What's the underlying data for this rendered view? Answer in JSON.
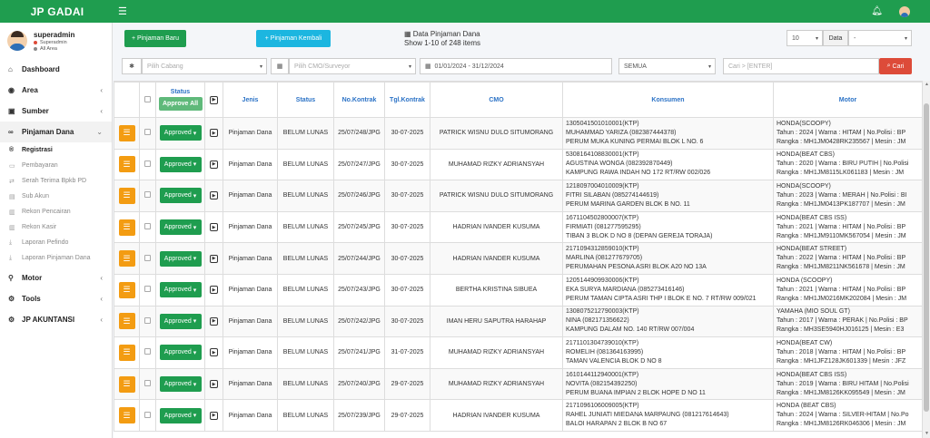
{
  "app": {
    "brand": "JP GADAI"
  },
  "icons": {
    "menu": "hamburger-icon",
    "bell": "bell-icon",
    "user": "user-avatar-icon"
  },
  "user": {
    "name": "superadmin",
    "role": "Superadmin",
    "area": "All Area"
  },
  "sidebar": {
    "items": [
      {
        "label": "Dashboard",
        "icon": "⌂",
        "has_children": false
      },
      {
        "label": "Area",
        "icon": "◉",
        "has_children": true
      },
      {
        "label": "Sumber",
        "icon": "▣",
        "has_children": true
      },
      {
        "label": "Pinjaman Dana",
        "icon": "∞",
        "has_children": true,
        "open": true
      }
    ],
    "submenu": [
      {
        "label": "Registrasi",
        "icon": "®",
        "active": true
      },
      {
        "label": "Pembayaran",
        "icon": "▭",
        "active": false
      },
      {
        "label": "Serah Terima Bpkb PD",
        "icon": "⇄",
        "active": false
      },
      {
        "label": "Sub Akun",
        "icon": "▤",
        "active": false
      },
      {
        "label": "Rekon Pencairan",
        "icon": "▥",
        "active": false
      },
      {
        "label": "Rekon Kasir",
        "icon": "▥",
        "active": false
      },
      {
        "label": "Laporan Pefindo",
        "icon": "⤓",
        "active": false
      },
      {
        "label": "Laporan Pinjaman Dana",
        "icon": "⤓",
        "active": false
      }
    ],
    "bottom_items": [
      {
        "label": "Motor",
        "icon": "⚲",
        "has_children": true
      },
      {
        "label": "Tools",
        "icon": "⚙",
        "has_children": true
      },
      {
        "label": "JP AKUNTANSI",
        "icon": "⚙",
        "has_children": true
      }
    ]
  },
  "toolbar": {
    "new_label": "+ Pinjaman Baru",
    "return_label": "+ Pinjaman Kembali",
    "info_title": "Data Pinjaman Dana",
    "info_count": "Show 1-10 of 248 items",
    "page_size": "10",
    "page_size_label": "Data",
    "extra_select": "-"
  },
  "filters": {
    "cabang_placeholder": "Pilih Cabang",
    "cmo_placeholder": "Pilih CMO/Surveyor",
    "date_range": "01/01/2024 - 31/12/2024",
    "status": "SEMUA",
    "search_placeholder": "Cari > [ENTER]",
    "search_button": "Cari"
  },
  "table": {
    "columns": {
      "status_header": "Status",
      "approve_all": "Approve All",
      "jenis": "Jenis",
      "status": "Status",
      "no_kontrak": "No.Kontrak",
      "tgl_kontrak": "Tgl.Kontrak",
      "cmo": "CMO",
      "konsumen": "Konsumen",
      "motor": "Motor"
    },
    "rows": [
      {
        "approval": "Approved",
        "jenis": "Pinjaman Dana",
        "status": "BELUM LUNAS",
        "no_kontrak": "25/07/248/JPG",
        "tgl": "30-07-2025",
        "cmo": "PATRICK WISNU DULO SITUMORANG",
        "konsumen": [
          "1305041501010001(KTP)",
          "MUHAMMAD YARIZA (082387444378)",
          "PERUM MUKA KUNING PERMAI BLOK L NO. 6"
        ],
        "motor": [
          "HONDA(SCOOPY)",
          "Tahun : 2024 | Warna : HITAM | No.Polisi : BP",
          "Rangka : MH1JM0428RK235567 | Mesin : JM"
        ]
      },
      {
        "approval": "Approved",
        "jenis": "Pinjaman Dana",
        "status": "BELUM LUNAS",
        "no_kontrak": "25/07/247/JPG",
        "tgl": "30-07-2025",
        "cmo": "MUHAMAD RIZKY ADRIANSYAH",
        "konsumen": [
          "5308164108830001(KTP)",
          "AGUSTINA WONGA (082392870449)",
          "KAMPUNG RAWA INDAH NO 172 RT/RW 002/026"
        ],
        "motor": [
          "HONDA(BEAT CBS)",
          "Tahun : 2020 | Warna : BIRU PUTIH | No.Polisi",
          "Rangka : MH1JM8115LK061183 | Mesin : JM"
        ]
      },
      {
        "approval": "Approved",
        "jenis": "Pinjaman Dana",
        "status": "BELUM LUNAS",
        "no_kontrak": "25/07/246/JPG",
        "tgl": "30-07-2025",
        "cmo": "PATRICK WISNU DULO SITUMORANG",
        "konsumen": [
          "1218097004010009(KTP)",
          "FITRI SILABAN (085274144619)",
          "PERUM MARINA GARDEN BLOK B NO. 11"
        ],
        "motor": [
          "HONDA(SCOOPY)",
          "Tahun : 2023 | Warna : MERAH | No.Polisi : BI",
          "Rangka : MH1JM0413PK187707 | Mesin : JM"
        ]
      },
      {
        "approval": "Approved",
        "jenis": "Pinjaman Dana",
        "status": "BELUM LUNAS",
        "no_kontrak": "25/07/245/JPG",
        "tgl": "30-07-2025",
        "cmo": "HADRIAN IVANDER KUSUMA",
        "konsumen": [
          "1671104502800007(KTP)",
          "FIRMIATI (081277595295)",
          "TIBAN 3 BLOK D NO 8 (DEPAN GEREJA TORAJA)"
        ],
        "motor": [
          "HONDA(BEAT CBS ISS)",
          "Tahun : 2021 | Warna : HITAM | No.Polisi : BP",
          "Rangka : MH1JM9110MK567054 | Mesin : JM"
        ]
      },
      {
        "approval": "Approved",
        "jenis": "Pinjaman Dana",
        "status": "BELUM LUNAS",
        "no_kontrak": "25/07/244/JPG",
        "tgl": "30-07-2025",
        "cmo": "HADRIAN IVANDER KUSUMA",
        "konsumen": [
          "2171094312859010(KTP)",
          "MARLINA (081277679705)",
          "PERUMAHAN PESONA ASRI BLOK A20 NO 13A"
        ],
        "motor": [
          "HONDA(BEAT STREET)",
          "Tahun : 2022 | Warna : HITAM | No.Polisi : BP",
          "Rangka : MH1JM8211NK561678 | Mesin : JM"
        ]
      },
      {
        "approval": "Approved",
        "jenis": "Pinjaman Dana",
        "status": "BELUM LUNAS",
        "no_kontrak": "25/07/243/JPG",
        "tgl": "30-07-2025",
        "cmo": "BERTHA KRISTINA SIBUEA",
        "konsumen": [
          "1205144909930006(KTP)",
          "EKA SURYA MARDIANA (085273416146)",
          "PERUM TAMAN CIPTA ASRI THP I BLOK E NO. 7 RT/RW 009/021"
        ],
        "motor": [
          "HONDA (SCOOPY)",
          "Tahun : 2021 | Warna : HITAM | No.Polisi : BP",
          "Rangka : MH1JM0216MK202084 | Mesin : JM"
        ]
      },
      {
        "approval": "Approved",
        "jenis": "Pinjaman Dana",
        "status": "BELUM LUNAS",
        "no_kontrak": "25/07/242/JPG",
        "tgl": "30-07-2025",
        "cmo": "IMAN HERU SAPUTRA HARAHAP",
        "konsumen": [
          "1308075212790003(KTP)",
          "NINA (082171356622)",
          "KAMPUNG DALAM NO. 140 RT/RW 007/004"
        ],
        "motor": [
          "YAMAHA (MIO SOUL GT)",
          "Tahun : 2017 | Warna : PERAK | No.Polisi : BP",
          "Rangka : MH3SE5940HJ016125 | Mesin : E3"
        ]
      },
      {
        "approval": "Approved",
        "jenis": "Pinjaman Dana",
        "status": "BELUM LUNAS",
        "no_kontrak": "25/07/241/JPG",
        "tgl": "31-07-2025",
        "cmo": "MUHAMAD RIZKY ADRIANSYAH",
        "konsumen": [
          "2171101304739010(KTP)",
          "ROMELIH (081364163995)",
          "TAMAN VALENCIA BLOK D NO 8"
        ],
        "motor": [
          "HONDA(BEAT CW)",
          "Tahun : 2018 | Warna : HITAM | No.Polisi : BP",
          "Rangka : MH1JFZ128JK601339 | Mesin : JFZ"
        ]
      },
      {
        "approval": "Approved",
        "jenis": "Pinjaman Dana",
        "status": "BELUM LUNAS",
        "no_kontrak": "25/07/240/JPG",
        "tgl": "29-07-2025",
        "cmo": "MUHAMAD RIZKY ADRIANSYAH",
        "konsumen": [
          "1610144112940001(KTP)",
          "NOVITA (082154392250)",
          "PERUM BUANA IMPIAN 2 BLOK HOPE D NO 11"
        ],
        "motor": [
          "HONDA(BEAT CBS ISS)",
          "Tahun : 2019 | Warna : BIRU HITAM | No.Polisi",
          "Rangka : MH1JM8126KK095549 | Mesin : JM"
        ]
      },
      {
        "approval": "Approved",
        "jenis": "Pinjaman Dana",
        "status": "BELUM LUNAS",
        "no_kontrak": "25/07/239/JPG",
        "tgl": "29-07-2025",
        "cmo": "HADRIAN IVANDER KUSUMA",
        "konsumen": [
          "2171096106009005(KTP)",
          "RAHEL JUNIATI MIEDANA MARPAUNG (081217614643)",
          "BALOI HARAPAN 2 BLOK B NO 67"
        ],
        "motor": [
          "HONDA (BEAT CBS)",
          "Tahun : 2024 | Warna : SILVER-HITAM | No.Po",
          "Rangka : MH1JM8126RK046306 | Mesin : JM"
        ]
      }
    ]
  }
}
